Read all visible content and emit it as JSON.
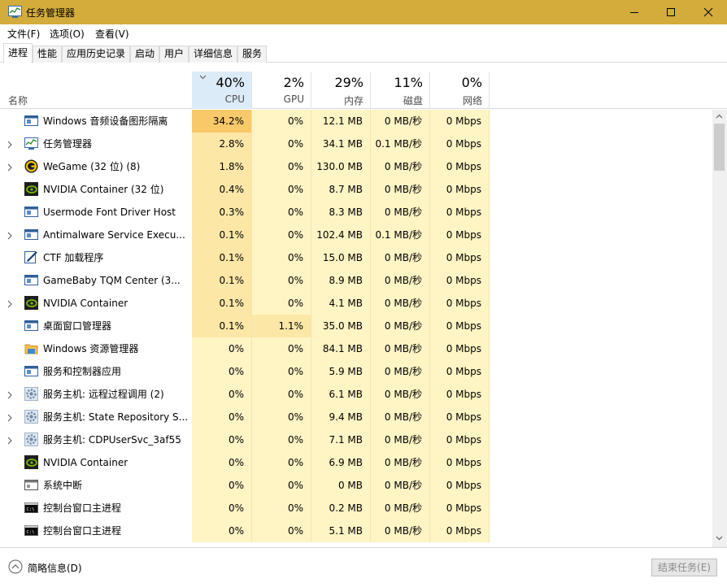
{
  "window": {
    "title": "任务管理器"
  },
  "menu": [
    "文件(F)",
    "选项(O)",
    "查看(V)"
  ],
  "tabs": [
    "进程",
    "性能",
    "应用历史记录",
    "启动",
    "用户",
    "详细信息",
    "服务"
  ],
  "active_tab": "进程",
  "columns": {
    "name_label": "名称",
    "cpu": {
      "pct": "40%",
      "label": "CPU"
    },
    "gpu": {
      "pct": "2%",
      "label": "GPU"
    },
    "memory": {
      "pct": "29%",
      "label": "内存"
    },
    "disk": {
      "pct": "11%",
      "label": "磁盘"
    },
    "network": {
      "pct": "0%",
      "label": "网络"
    }
  },
  "colors": {
    "titlebar": "#d4ac3c",
    "cell_light": "#fff4c4",
    "cell_medium": "#fde7a6",
    "cell_strong": "#f8c969",
    "sorted_header": "#dcebf8"
  },
  "processes": [
    {
      "name": "Windows 音频设备图形隔离",
      "icon": "app-window-icon",
      "expandable": false,
      "cpu": "34.2%",
      "gpu": "0%",
      "memory": "12.1 MB",
      "disk": "0 MB/秒",
      "network": "0 Mbps",
      "cpu_heat": 3,
      "gpu_heat": 0,
      "mem_heat": 0,
      "disk_heat": 0
    },
    {
      "name": "任务管理器",
      "icon": "task-manager-icon",
      "expandable": true,
      "cpu": "2.8%",
      "gpu": "0%",
      "memory": "34.1 MB",
      "disk": "0.1 MB/秒",
      "network": "0 Mbps",
      "cpu_heat": 1,
      "gpu_heat": 0,
      "mem_heat": 0,
      "disk_heat": 0
    },
    {
      "name": "WeGame (32 位) (8)",
      "icon": "wegame-icon",
      "expandable": true,
      "cpu": "1.8%",
      "gpu": "0%",
      "memory": "130.0 MB",
      "disk": "0 MB/秒",
      "network": "0 Mbps",
      "cpu_heat": 1,
      "gpu_heat": 0,
      "mem_heat": 0,
      "disk_heat": 0
    },
    {
      "name": "NVIDIA Container (32 位)",
      "icon": "nvidia-icon",
      "expandable": false,
      "cpu": "0.4%",
      "gpu": "0%",
      "memory": "8.7 MB",
      "disk": "0 MB/秒",
      "network": "0 Mbps",
      "cpu_heat": 1,
      "gpu_heat": 0,
      "mem_heat": 0,
      "disk_heat": 0
    },
    {
      "name": "Usermode Font Driver Host",
      "icon": "app-window-icon",
      "expandable": false,
      "cpu": "0.3%",
      "gpu": "0%",
      "memory": "8.3 MB",
      "disk": "0 MB/秒",
      "network": "0 Mbps",
      "cpu_heat": 1,
      "gpu_heat": 0,
      "mem_heat": 0,
      "disk_heat": 0
    },
    {
      "name": "Antimalware Service Execu...",
      "icon": "app-window-icon",
      "expandable": true,
      "cpu": "0.1%",
      "gpu": "0%",
      "memory": "102.4 MB",
      "disk": "0.1 MB/秒",
      "network": "0 Mbps",
      "cpu_heat": 1,
      "gpu_heat": 0,
      "mem_heat": 0,
      "disk_heat": 0
    },
    {
      "name": "CTF 加载程序",
      "icon": "ctf-pen-icon",
      "expandable": false,
      "cpu": "0.1%",
      "gpu": "0%",
      "memory": "15.0 MB",
      "disk": "0 MB/秒",
      "network": "0 Mbps",
      "cpu_heat": 1,
      "gpu_heat": 0,
      "mem_heat": 0,
      "disk_heat": 0
    },
    {
      "name": "GameBaby TQM Center (3...",
      "icon": "app-window-icon",
      "expandable": false,
      "cpu": "0.1%",
      "gpu": "0%",
      "memory": "8.9 MB",
      "disk": "0 MB/秒",
      "network": "0 Mbps",
      "cpu_heat": 1,
      "gpu_heat": 0,
      "mem_heat": 0,
      "disk_heat": 0
    },
    {
      "name": "NVIDIA Container",
      "icon": "nvidia-icon",
      "expandable": true,
      "cpu": "0.1%",
      "gpu": "0%",
      "memory": "4.1 MB",
      "disk": "0 MB/秒",
      "network": "0 Mbps",
      "cpu_heat": 1,
      "gpu_heat": 0,
      "mem_heat": 0,
      "disk_heat": 0
    },
    {
      "name": "桌面窗口管理器",
      "icon": "app-window-icon",
      "expandable": false,
      "cpu": "0.1%",
      "gpu": "1.1%",
      "memory": "35.0 MB",
      "disk": "0 MB/秒",
      "network": "0 Mbps",
      "cpu_heat": 1,
      "gpu_heat": 1,
      "mem_heat": 0,
      "disk_heat": 0
    },
    {
      "name": "Windows 资源管理器",
      "icon": "folder-icon",
      "expandable": false,
      "cpu": "0%",
      "gpu": "0%",
      "memory": "84.1 MB",
      "disk": "0 MB/秒",
      "network": "0 Mbps",
      "cpu_heat": 0,
      "gpu_heat": 0,
      "mem_heat": 0,
      "disk_heat": 0
    },
    {
      "name": "服务和控制器应用",
      "icon": "app-window-icon",
      "expandable": false,
      "cpu": "0%",
      "gpu": "0%",
      "memory": "5.9 MB",
      "disk": "0 MB/秒",
      "network": "0 Mbps",
      "cpu_heat": 0,
      "gpu_heat": 0,
      "mem_heat": 0,
      "disk_heat": 0
    },
    {
      "name": "服务主机: 远程过程调用 (2)",
      "icon": "gear-icon",
      "expandable": true,
      "cpu": "0%",
      "gpu": "0%",
      "memory": "6.1 MB",
      "disk": "0 MB/秒",
      "network": "0 Mbps",
      "cpu_heat": 0,
      "gpu_heat": 0,
      "mem_heat": 0,
      "disk_heat": 0
    },
    {
      "name": "服务主机: State Repository S...",
      "icon": "gear-icon",
      "expandable": true,
      "cpu": "0%",
      "gpu": "0%",
      "memory": "9.4 MB",
      "disk": "0 MB/秒",
      "network": "0 Mbps",
      "cpu_heat": 0,
      "gpu_heat": 0,
      "mem_heat": 0,
      "disk_heat": 0
    },
    {
      "name": "服务主机: CDPUserSvc_3af55",
      "icon": "gear-icon",
      "expandable": true,
      "cpu": "0%",
      "gpu": "0%",
      "memory": "7.1 MB",
      "disk": "0 MB/秒",
      "network": "0 Mbps",
      "cpu_heat": 0,
      "gpu_heat": 0,
      "mem_heat": 0,
      "disk_heat": 0
    },
    {
      "name": "NVIDIA Container",
      "icon": "nvidia-icon",
      "expandable": false,
      "cpu": "0%",
      "gpu": "0%",
      "memory": "6.9 MB",
      "disk": "0 MB/秒",
      "network": "0 Mbps",
      "cpu_heat": 0,
      "gpu_heat": 0,
      "mem_heat": 0,
      "disk_heat": 0
    },
    {
      "name": "系统中断",
      "icon": "system-interrupt-icon",
      "expandable": false,
      "cpu": "0%",
      "gpu": "0%",
      "memory": "0 MB",
      "disk": "0 MB/秒",
      "network": "0 Mbps",
      "cpu_heat": 0,
      "gpu_heat": 0,
      "mem_heat": 0,
      "disk_heat": 0
    },
    {
      "name": "控制台窗口主进程",
      "icon": "console-icon",
      "expandable": false,
      "cpu": "0%",
      "gpu": "0%",
      "memory": "0.2 MB",
      "disk": "0 MB/秒",
      "network": "0 Mbps",
      "cpu_heat": 0,
      "gpu_heat": 0,
      "mem_heat": 0,
      "disk_heat": 0
    },
    {
      "name": "控制台窗口主进程",
      "icon": "console-icon",
      "expandable": false,
      "cpu": "0%",
      "gpu": "0%",
      "memory": "5.1 MB",
      "disk": "0 MB/秒",
      "network": "0 Mbps",
      "cpu_heat": 0,
      "gpu_heat": 0,
      "mem_heat": 0,
      "disk_heat": 0
    }
  ],
  "footer": {
    "fewer_details": "简略信息(D)",
    "end_task": "结束任务(E)"
  }
}
